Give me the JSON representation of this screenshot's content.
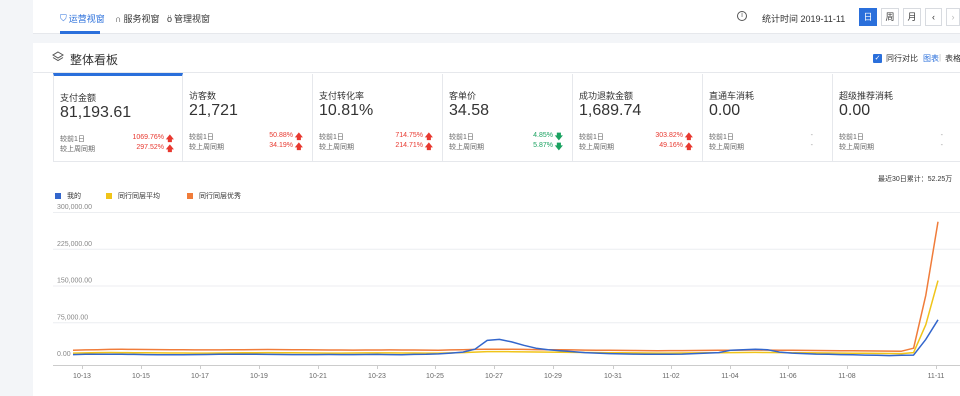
{
  "nav": {
    "tabs": [
      {
        "label": "运营视窗",
        "icon": "shield-icon"
      },
      {
        "label": "服务视窗",
        "icon": "headset-icon"
      },
      {
        "label": "管理视窗",
        "icon": "medal-icon"
      }
    ],
    "stat_time": "统计时间 2019-11-11",
    "period": [
      "日",
      "周",
      "月"
    ],
    "prev_icon": "chevron-left-icon",
    "next_icon": "chevron-right-icon",
    "info_icon": "info-icon"
  },
  "board": {
    "title": "整体看板",
    "peer_compare": "同行对比",
    "view_chart": "图表",
    "separator": "|",
    "view_table": "表格"
  },
  "metrics": [
    {
      "label": "支付金额",
      "value": "81,193.61",
      "r1_label": "较前1日",
      "r1_pct": "1069.76%",
      "r1_dir": "up",
      "r2_label": "较上周同期",
      "r2_pct": "297.52%",
      "r2_dir": "up"
    },
    {
      "label": "访客数",
      "value": "21,721",
      "r1_label": "较前1日",
      "r1_pct": "50.88%",
      "r1_dir": "up",
      "r2_label": "较上周同期",
      "r2_pct": "34.19%",
      "r2_dir": "up"
    },
    {
      "label": "支付转化率",
      "value": "10.81%",
      "r1_label": "较前1日",
      "r1_pct": "714.75%",
      "r1_dir": "up",
      "r2_label": "较上周同期",
      "r2_pct": "214.71%",
      "r2_dir": "up"
    },
    {
      "label": "客单价",
      "value": "34.58",
      "r1_label": "较前1日",
      "r1_pct": "4.85%",
      "r1_dir": "down",
      "r2_label": "较上周同期",
      "r2_pct": "5.87%",
      "r2_dir": "down"
    },
    {
      "label": "成功退款金额",
      "value": "1,689.74",
      "r1_label": "较前1日",
      "r1_pct": "303.82%",
      "r1_dir": "up",
      "r2_label": "较上周同期",
      "r2_pct": "49.16%",
      "r2_dir": "up"
    },
    {
      "label": "直通车消耗",
      "value": "0.00",
      "r1_label": "较前1日",
      "r1_pct": "-",
      "r1_dir": "none",
      "r2_label": "较上周同期",
      "r2_pct": "-",
      "r2_dir": "none"
    },
    {
      "label": "超级推荐消耗",
      "value": "0.00",
      "r1_label": "较前1日",
      "r1_pct": "-",
      "r1_dir": "none",
      "r2_label": "较上周同期",
      "r2_pct": "-",
      "r2_dir": "none"
    }
  ],
  "arrows": {
    "up": "🡅",
    "down": "🡇"
  },
  "recent_total": "最近30日累计：52.25万",
  "colors": {
    "mine": "#3366cc",
    "peer_avg": "#f0c419",
    "peer_top": "#f07c3a",
    "accent": "#2a6fdb"
  },
  "chart_data": {
    "type": "line",
    "series": [
      {
        "name": "我的",
        "values": [
          9000,
          9500,
          9800,
          9500,
          9600,
          9400,
          9000,
          8800,
          8600,
          8800,
          9000,
          9200,
          9500,
          9600,
          9800,
          9700,
          9400,
          9200,
          9000,
          8900,
          9000,
          9100,
          9000,
          8900,
          9200,
          9300,
          9000,
          8800,
          9300,
          9600,
          10500,
          12000,
          14000,
          20000,
          38000,
          40000,
          35000,
          28000,
          22000,
          19000,
          17000,
          15000,
          13000,
          12000,
          11000,
          10500,
          10000,
          9800,
          9600,
          9800,
          10000,
          11000,
          12000,
          13000,
          18000,
          19000,
          20000,
          19000,
          14000,
          12000,
          11000,
          10000,
          9500,
          9000,
          8500,
          8000,
          7500,
          7000,
          7500,
          8000,
          40000,
          80000
        ]
      },
      {
        "name": "同行同层平均",
        "values": [
          12000,
          12500,
          13000,
          13200,
          13000,
          12800,
          12600,
          12400,
          12300,
          12200,
          12000,
          12100,
          12200,
          12400,
          12600,
          12800,
          13000,
          12800,
          12600,
          12400,
          12200,
          12000,
          12100,
          12200,
          12400,
          12500,
          12400,
          12300,
          12200,
          12000,
          12000,
          12500,
          13000,
          14000,
          15000,
          15000,
          14800,
          14500,
          14200,
          14000,
          13800,
          13500,
          13200,
          13000,
          12800,
          12600,
          12400,
          12200,
          12000,
          12100,
          12200,
          12400,
          12600,
          12800,
          13000,
          13200,
          13400,
          13200,
          13000,
          12800,
          12600,
          12400,
          12200,
          12000,
          11800,
          11600,
          11400,
          11200,
          11000,
          13000,
          70000,
          160000
        ]
      },
      {
        "name": "同行同层优秀",
        "values": [
          18000,
          18500,
          19000,
          19500,
          19800,
          19600,
          19400,
          19200,
          19000,
          18800,
          18600,
          18500,
          18600,
          18800,
          19000,
          19200,
          19400,
          19200,
          19000,
          18800,
          18600,
          18400,
          18300,
          18200,
          18300,
          18400,
          18500,
          18400,
          18300,
          18200,
          18000,
          18500,
          19000,
          19500,
          20000,
          20000,
          19800,
          19500,
          19200,
          19000,
          18800,
          18500,
          18200,
          18000,
          17800,
          17600,
          17400,
          17200,
          17000,
          17100,
          17200,
          17400,
          17600,
          17800,
          18000,
          18200,
          18400,
          18200,
          18000,
          17800,
          17600,
          17400,
          17200,
          17000,
          16800,
          16600,
          16400,
          16200,
          16000,
          22000,
          130000,
          280000
        ]
      }
    ],
    "y_ticks": [
      "300,000.00",
      "225,000.00",
      "150,000.00",
      "75,000.00",
      "0.00"
    ],
    "ylim": [
      0,
      300000
    ],
    "x_ticks": [
      "10-13",
      "10-15",
      "10-17",
      "10-19",
      "10-21",
      "10-23",
      "10-25",
      "10-27",
      "10-29",
      "10-31",
      "11-02",
      "11-04",
      "11-06",
      "11-08",
      "11-11"
    ],
    "grid": true,
    "legend": "top-left"
  }
}
